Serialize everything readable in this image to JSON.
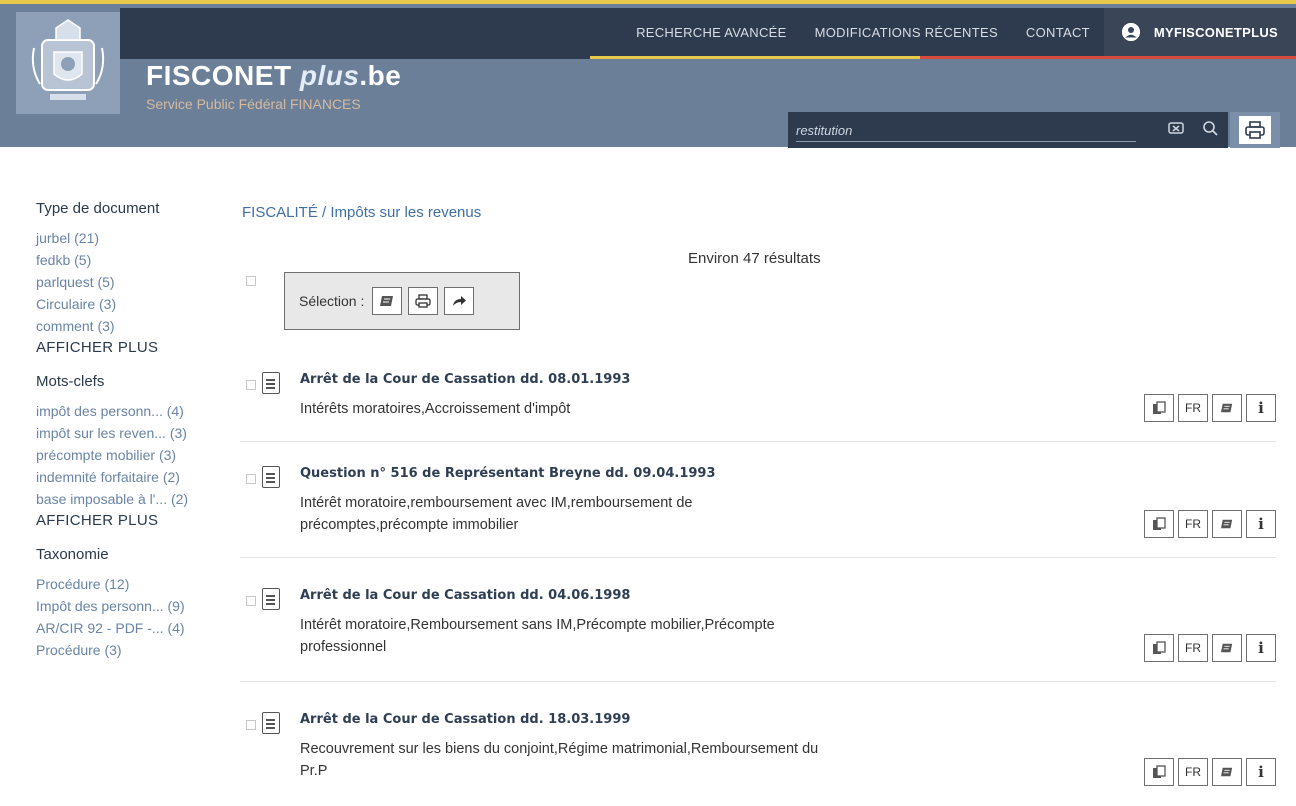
{
  "header": {
    "nav": [
      "RECHERCHE AVANCÉE",
      "MODIFICATIONS RÉCENTES",
      "CONTACT"
    ],
    "myfis_label": "MYFISCONETPLUS",
    "brand_main": "FISCONET",
    "brand_plus": "plus",
    "brand_tld": ".be",
    "brand_sub": "Service Public Fédéral FINANCES",
    "stripe_colors": [
      "#e8c94a",
      "#d84a3c"
    ],
    "search_value": "restitution",
    "search_icons": [
      "clear-icon",
      "search-icon"
    ],
    "print_icon": "printer-icon"
  },
  "facets": [
    {
      "title": "Type de document",
      "items": [
        "jurbel (21)",
        "fedkb (5)",
        "parlquest (5)",
        "Circulaire (3)",
        "comment (3)"
      ],
      "more": "AFFICHER PLUS"
    },
    {
      "title": "Mots-clefs",
      "items": [
        "impôt des personn... (4)",
        "impôt sur les reven... (3)",
        "précompte mobilier (3)",
        "indemnité forfaitaire (2)",
        "base imposable à l'... (2)"
      ],
      "more": "AFFICHER PLUS"
    },
    {
      "title": "Taxonomie",
      "items": [
        "Procédure (12)",
        "Impôt des personn... (9)",
        "AR/CIR 92 - PDF -... (4)",
        "Procédure (3)"
      ],
      "more": ""
    }
  ],
  "breadcrumb": "FISCALITÉ / Impôts sur les revenus",
  "result_count": "Environ 47 résultats",
  "selection_label": "Sélection :",
  "results": [
    {
      "title": "Arrêt de la Cour de Cassation dd. 08.01.1993",
      "keywords": "Intérêts moratoires,Accroissement d'impôt"
    },
    {
      "title": "Question n° 516 de Représentant Breyne dd. 09.04.1993",
      "keywords": "Intérêt moratoire,remboursement avec IM,remboursement de précomptes,précompte immobilier"
    },
    {
      "title": "Arrêt de la Cour de Cassation dd. 04.06.1998",
      "keywords": "Intérêt moratoire,Remboursement sans IM,Précompte mobilier,Précompte professionnel"
    },
    {
      "title": "Arrêt de la Cour de Cassation dd. 18.03.1999",
      "keywords": "Recouvrement sur les biens du conjoint,Régime matrimonial,Remboursement du Pr.P"
    }
  ],
  "result_actions": {
    "lang": "FR",
    "info": "i",
    "icons": [
      "copy-icon",
      "lang-button",
      "stack-icon",
      "info-icon"
    ]
  }
}
